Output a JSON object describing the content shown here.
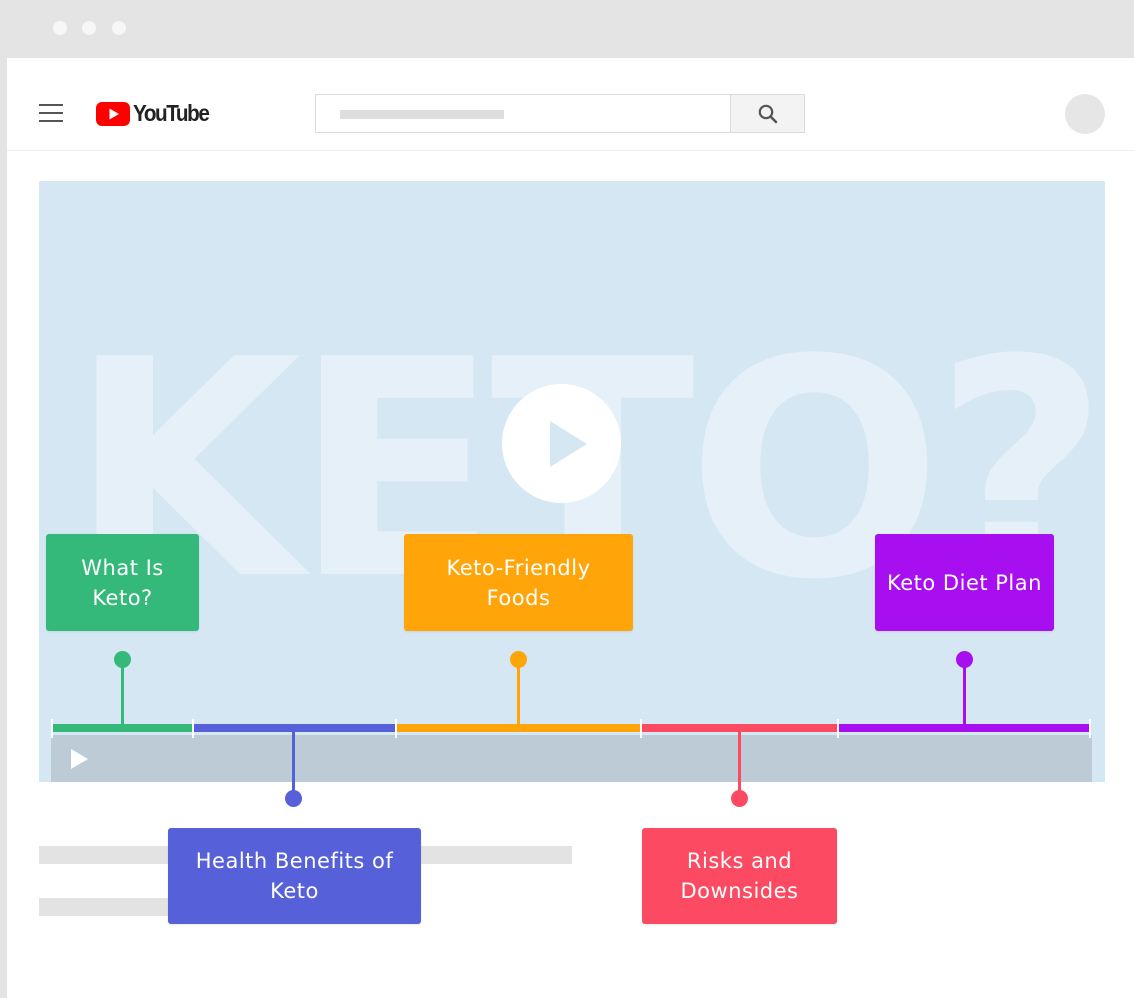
{
  "window": {
    "dots": [
      "window-dot-1",
      "window-dot-2",
      "window-dot-3"
    ]
  },
  "header": {
    "logo_text": "YouTube",
    "menu_icon": "hamburger-menu-icon",
    "search_icon": "search-icon",
    "avatar": "avatar"
  },
  "video": {
    "background_word": "KETO?",
    "play_icon": "play-icon"
  },
  "chapters": [
    {
      "id": "what-is-keto",
      "label": "What Is Keto?",
      "color": "#34b97a",
      "position": "above"
    },
    {
      "id": "health-benefits",
      "label": "Health Benefits of Keto",
      "color": "#5560d9",
      "position": "below"
    },
    {
      "id": "keto-friendly-foods",
      "label": "Keto-Friendly Foods",
      "color": "#ffa50a",
      "position": "above"
    },
    {
      "id": "risks-downsides",
      "label": "Risks and Downsides",
      "color": "#fb4a61",
      "position": "below"
    },
    {
      "id": "keto-diet-plan",
      "label": "Keto Diet Plan",
      "color": "#a80ff0",
      "position": "above"
    }
  ],
  "colors": {
    "youtube_red": "#ff0000",
    "video_bg": "#d6e7f4",
    "player_bar": "#bccbd5"
  }
}
